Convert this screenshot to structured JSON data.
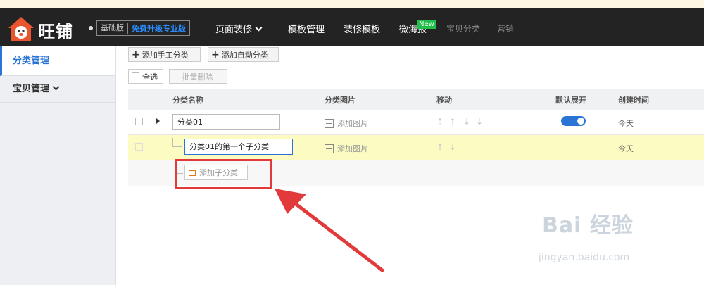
{
  "brand": {
    "name": "旺铺",
    "edition_basic": "基础版",
    "edition_upgrade": "免费升级专业版"
  },
  "nav": {
    "page_decor": "页面装修",
    "template_manage": "模板管理",
    "decor_template": "装修模板",
    "micro_poster": "微海报",
    "new_badge": "New",
    "item_category": "宝贝分类",
    "marketing": "营销"
  },
  "sidebar": {
    "items": [
      {
        "label": "分类管理"
      },
      {
        "label": "宝贝管理"
      }
    ]
  },
  "toolbar": {
    "add_manual": "添加手工分类",
    "add_auto": "添加自动分类",
    "select_all": "全选",
    "batch_delete": "批量删除"
  },
  "table": {
    "headers": [
      "分类名称",
      "分类图片",
      "移动",
      "默认展开",
      "创建时间"
    ],
    "rows": [
      {
        "name": "分类01",
        "image_action": "添加图片",
        "created": "今天",
        "expanded": true
      },
      {
        "name": "分类01的第一个子分类",
        "image_action": "添加图片",
        "created": "今天"
      }
    ],
    "add_sub_label": "添加子分类"
  },
  "watermark": {
    "main": "Bai 经验",
    "sub": "jingyan.baidu.com"
  },
  "colors": {
    "accent": "#2a74d6",
    "highlight_red": "#e23a3a",
    "row_highlight": "#fcfcc2",
    "topbar": "#232323"
  }
}
